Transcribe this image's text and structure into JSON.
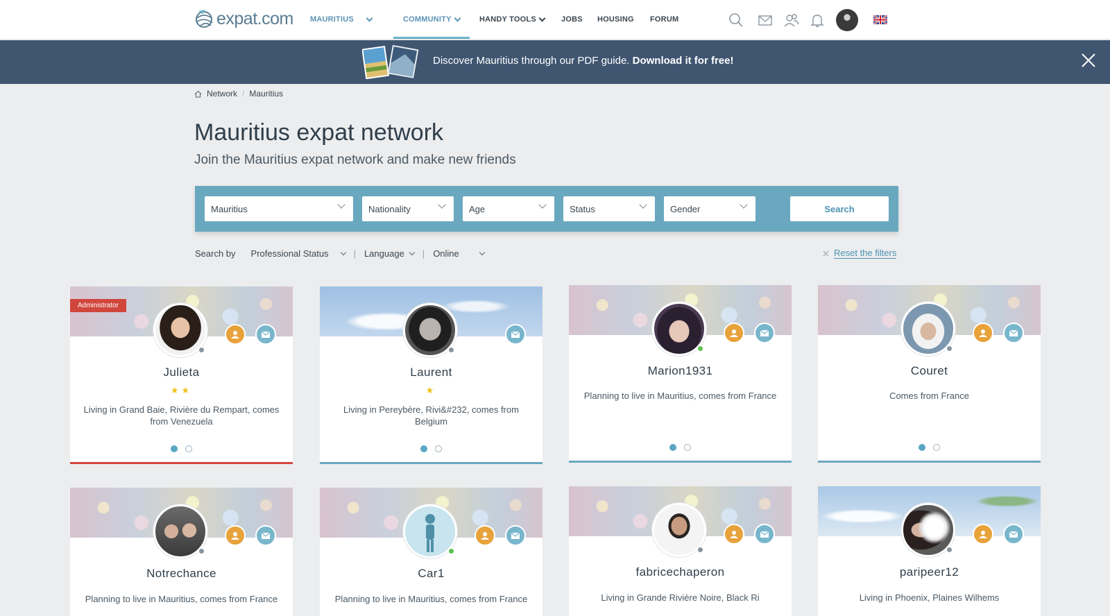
{
  "nav": {
    "logo": "expat.com",
    "country": "MAURITIUS",
    "community": "COMMUNITY",
    "tools": "HANDY TOOLS",
    "jobs": "JOBS",
    "housing": "HOUSING",
    "forum": "FORUM"
  },
  "banner": {
    "text": "Discover Mauritius through our PDF guide.",
    "cta": "Download it for free!"
  },
  "breadcrumb": [
    "Network",
    "Mauritius"
  ],
  "page": {
    "title": "Mauritius expat network",
    "subtitle": "Join the Mauritius expat network and make new friends"
  },
  "filters": {
    "country": "Mauritius",
    "nationality": "Nationality",
    "age": "Age",
    "status": "Status",
    "gender": "Gender",
    "search": "Search"
  },
  "searchby": {
    "label": "Search by",
    "professional": "Professional Status",
    "language": "Language",
    "online": "Online",
    "reset": "Reset the filters"
  },
  "colors": {
    "accent": "#6aa8c0",
    "admin": "#d1463c",
    "friend": "#e8a23a",
    "message": "#78b6cc"
  },
  "cards": [
    {
      "name": "Julieta",
      "badge": "Administrator",
      "stars": "★★",
      "desc": "Living in Grand Baie, Rivière du Rempart, comes from Venezuela"
    },
    {
      "name": "Laurent",
      "stars": "★",
      "desc": "Living in Pereybère, Rivi&#232, comes from Belgium"
    },
    {
      "name": "Marion1931",
      "desc": "Planning to live in Mauritius, comes from France"
    },
    {
      "name": "Couret",
      "desc": "Comes from France"
    },
    {
      "name": "Notrechance",
      "desc": "Planning to live in Mauritius, comes from France"
    },
    {
      "name": "Car1",
      "desc": "Planning to live in Mauritius, comes from France"
    },
    {
      "name": "fabricechaperon",
      "desc": "Living in Grande Rivière Noire, Black Ri"
    },
    {
      "name": "paripeer12",
      "desc": "Living in Phoenix, Plaines Wilhems"
    }
  ]
}
